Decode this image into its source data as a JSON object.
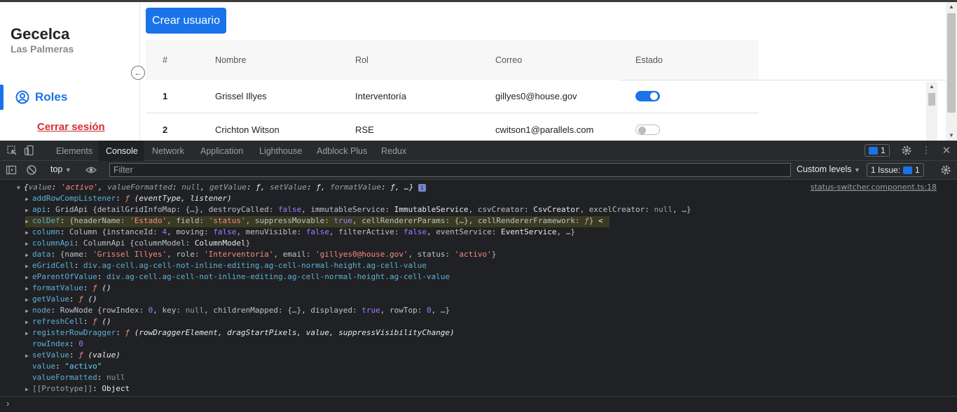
{
  "app": {
    "brand_name": "Gecelca",
    "brand_sub": "Las Palmeras",
    "nav_roles": "Roles",
    "logout": "Cerrar sesión",
    "create_button": "Crear usuario",
    "table": {
      "headers": [
        "#",
        "Nombre",
        "Rol",
        "Correo",
        "Estado"
      ],
      "rows": [
        {
          "num": "1",
          "name": "Grissel Illyes",
          "role": "Interventoría",
          "email": "gillyes0@house.gov",
          "active": true
        },
        {
          "num": "2",
          "name": "Crichton Witson",
          "role": "RSE",
          "email": "cwitson1@parallels.com",
          "active": false
        }
      ]
    }
  },
  "devtools": {
    "tabs": [
      "Elements",
      "Console",
      "Network",
      "Application",
      "Lighthouse",
      "Adblock Plus",
      "Redux"
    ],
    "active_tab": "Console",
    "issues_badge": "1",
    "context": "top",
    "filter_placeholder": "Filter",
    "levels": "Custom levels",
    "issues_label": "1 Issue:",
    "issues_count": "1",
    "source_link": "status-switcher.component.ts:18"
  },
  "colors": {
    "accent": "#1a73e8",
    "logout": "#d32f2f",
    "console_bg": "#202124"
  }
}
